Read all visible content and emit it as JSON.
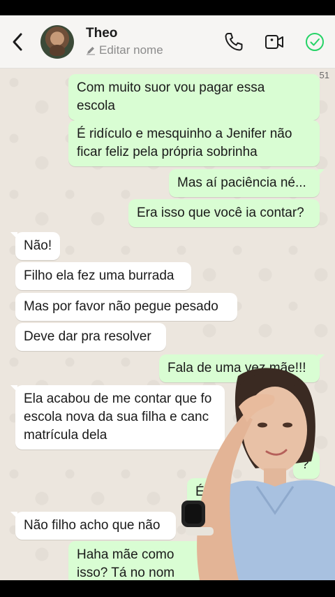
{
  "header": {
    "contact_name": "Theo",
    "contact_subtitle": "Editar nome",
    "icons": [
      "back-arrow-icon",
      "avatar",
      "phone-icon",
      "video-call-icon",
      "check-circle-icon"
    ],
    "accent_color": "#25d366"
  },
  "chat": {
    "corner_number": "51",
    "messages": [
      {
        "side": "out",
        "lines": [
          "Com muito suor vou pagar essa",
          "escola"
        ]
      },
      {
        "side": "out",
        "lines": [
          "É ridículo e mesquinho a Jenifer não",
          "ficar feliz pela própria sobrinha"
        ]
      },
      {
        "side": "out",
        "lines": [
          "Mas aí paciência né..."
        ]
      },
      {
        "side": "out",
        "lines": [
          "Era isso que você ia contar?"
        ]
      },
      {
        "side": "in",
        "lines": [
          "Não!"
        ]
      },
      {
        "side": "in",
        "lines": [
          "Filho ela fez uma burrada"
        ]
      },
      {
        "side": "in",
        "lines": [
          "Mas por favor não pegue pesado"
        ]
      },
      {
        "side": "in",
        "lines": [
          "Deve dar pra resolver"
        ]
      },
      {
        "side": "out",
        "lines": [
          "Fala de uma vez mãe!!!"
        ]
      },
      {
        "side": "in",
        "lines": [
          "Ela acabou de me contar que fo",
          "escola nova da sua filha e canc",
          "matrícula dela"
        ]
      },
      {
        "side": "out",
        "lines": [
          "?"
        ]
      },
      {
        "side": "out",
        "lines": [
          "É"
        ]
      },
      {
        "side": "in",
        "lines": [
          "Não filho acho que não"
        ]
      },
      {
        "side": "out",
        "lines": [
          "Haha mãe como",
          "isso? Tá no nom"
        ]
      }
    ],
    "colors": {
      "outgoing": "#d9fdd3",
      "incoming": "#ffffff",
      "wallpaper": "#ece6de"
    }
  }
}
